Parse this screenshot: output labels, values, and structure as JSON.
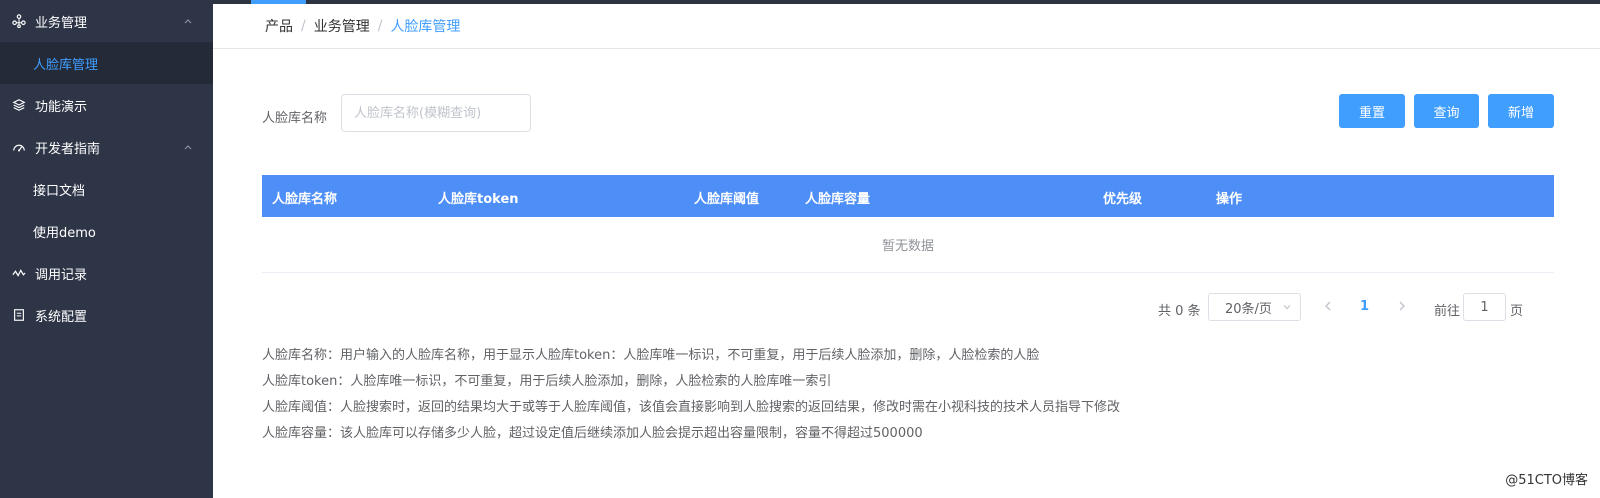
{
  "sidebar": {
    "business": {
      "label": "业务管理"
    },
    "face_lib": {
      "label": "人脸库管理"
    },
    "demo": {
      "label": "功能演示"
    },
    "dev_guide": {
      "label": "开发者指南"
    },
    "api_docs": {
      "label": "接口文档"
    },
    "use_demo": {
      "label": "使用demo"
    },
    "call_log": {
      "label": "调用记录"
    },
    "sys_config": {
      "label": "系统配置"
    }
  },
  "breadcrumb": {
    "items": [
      "产品",
      "业务管理",
      "人脸库管理"
    ],
    "separator": "/"
  },
  "filter": {
    "label": "人脸库名称",
    "placeholder": "人脸库名称(模糊查询)"
  },
  "buttons": {
    "reset": "重置",
    "query": "查询",
    "add": "新增"
  },
  "table": {
    "columns": [
      "人脸库名称",
      "人脸库token",
      "人脸库阈值",
      "人脸库容量",
      "优先级",
      "操作"
    ],
    "empty_text": "暂无数据"
  },
  "pagination": {
    "total": "共 0 条",
    "page_size": "20条/页",
    "current_page": "1",
    "goto_label": "前往",
    "goto_value": "1",
    "page_suffix": "页"
  },
  "notes": [
    "人脸库名称：用户输入的人脸库名称，用于显示人脸库token：人脸库唯一标识，不可重复，用于后续人脸添加，删除，人脸检索的人脸",
    "人脸库token：人脸库唯一标识，不可重复，用于后续人脸添加，删除，人脸检索的人脸库唯一索引",
    "人脸库阈值：人脸搜索时，返回的结果均大于或等于人脸库阈值，该值会直接影响到人脸搜索的返回结果，修改时需在小视科技的技术人员指导下修改",
    "人脸库容量：该人脸库可以存储多少人脸，超过设定值后继续添加人脸会提示超出容量限制，容量不得超过500000"
  ],
  "watermark": "@51CTO博客",
  "colors": {
    "sidebar_bg": "#2e3547",
    "sidebar_sub_bg": "#242a38",
    "accent": "#409eff",
    "table_header": "#4d8ef7"
  }
}
